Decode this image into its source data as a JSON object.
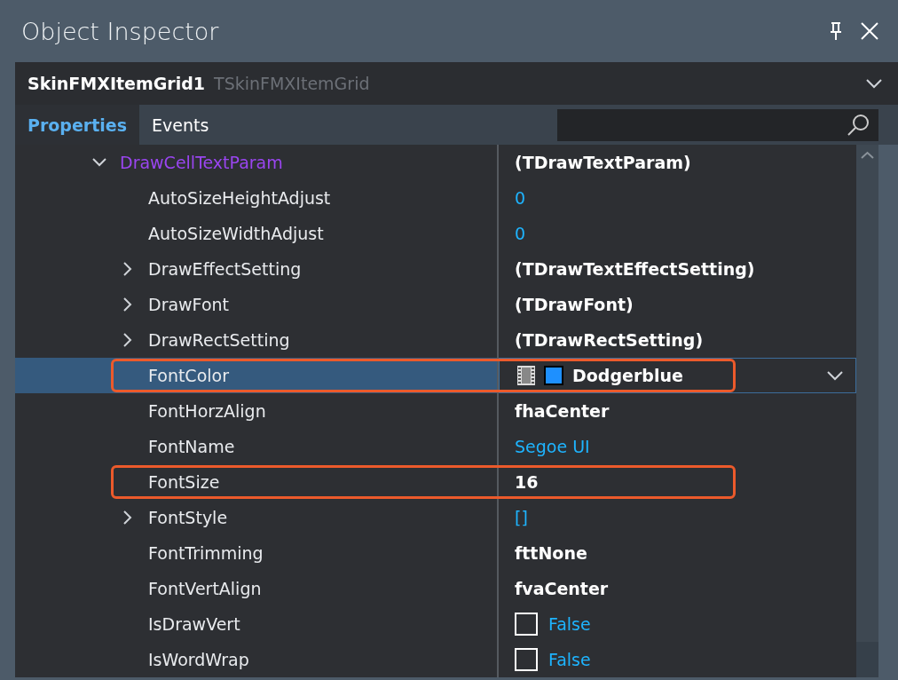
{
  "panel": {
    "title": "Object Inspector"
  },
  "component": {
    "name": "SkinFMXItemGrid1",
    "type": "TSkinFMXItemGrid"
  },
  "tabs": [
    {
      "label": "Properties",
      "selected": true
    },
    {
      "label": "Events",
      "selected": false
    }
  ],
  "properties": [
    {
      "name": "DrawCellTextParam",
      "expandable": true,
      "expanded": true,
      "kind": "object",
      "value": "(TDrawTextParam)",
      "selected": false,
      "highlighted": false,
      "children": [
        {
          "name": "AutoSizeHeightAdjust",
          "expandable": false,
          "kind": "default",
          "value": "0",
          "selected": false,
          "highlighted": false
        },
        {
          "name": "AutoSizeWidthAdjust",
          "expandable": false,
          "kind": "default",
          "value": "0",
          "selected": false,
          "highlighted": false
        },
        {
          "name": "DrawEffectSetting",
          "expandable": true,
          "expanded": false,
          "kind": "object",
          "value": "(TDrawTextEffectSetting)",
          "selected": false,
          "highlighted": false
        },
        {
          "name": "DrawFont",
          "expandable": true,
          "expanded": false,
          "kind": "object",
          "value": "(TDrawFont)",
          "selected": false,
          "highlighted": false
        },
        {
          "name": "DrawRectSetting",
          "expandable": true,
          "expanded": false,
          "kind": "object",
          "value": "(TDrawRectSetting)",
          "selected": false,
          "highlighted": false
        },
        {
          "name": "FontColor",
          "expandable": false,
          "kind": "color",
          "value": "Dodgerblue",
          "color": "#1e90ff",
          "selected": true,
          "highlighted": true
        },
        {
          "name": "FontHorzAlign",
          "expandable": false,
          "kind": "modified",
          "value": "fhaCenter",
          "selected": false,
          "highlighted": false
        },
        {
          "name": "FontName",
          "expandable": false,
          "kind": "default",
          "value": "Segoe UI",
          "selected": false,
          "highlighted": false
        },
        {
          "name": "FontSize",
          "expandable": false,
          "kind": "modified",
          "value": "16",
          "selected": false,
          "highlighted": true
        },
        {
          "name": "FontStyle",
          "expandable": true,
          "expanded": false,
          "kind": "default",
          "value": "[]",
          "selected": false,
          "highlighted": false
        },
        {
          "name": "FontTrimming",
          "expandable": false,
          "kind": "modified",
          "value": "fttNone",
          "selected": false,
          "highlighted": false
        },
        {
          "name": "FontVertAlign",
          "expandable": false,
          "kind": "modified",
          "value": "fvaCenter",
          "selected": false,
          "highlighted": false
        },
        {
          "name": "IsDrawVert",
          "expandable": false,
          "kind": "bool",
          "value": "False",
          "checked": false,
          "selected": false,
          "highlighted": false
        },
        {
          "name": "IsWordWrap",
          "expandable": false,
          "kind": "bool",
          "value": "False",
          "checked": false,
          "selected": false,
          "highlighted": false
        }
      ]
    }
  ]
}
